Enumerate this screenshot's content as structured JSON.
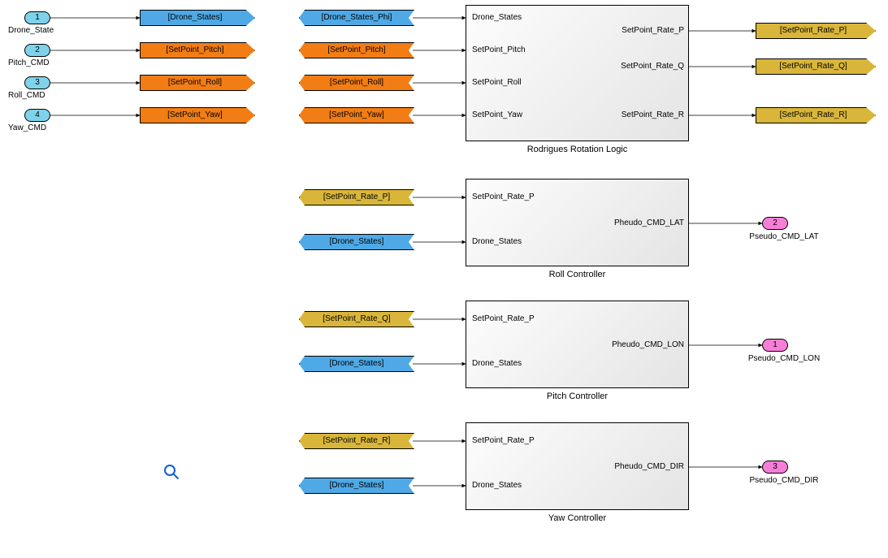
{
  "inports": [
    {
      "num": "1",
      "label": "Drone_State"
    },
    {
      "num": "2",
      "label": "Pitch_CMD"
    },
    {
      "num": "3",
      "label": "Roll_CMD"
    },
    {
      "num": "4",
      "label": "Yaw_CMD"
    }
  ],
  "goto_left": [
    {
      "text": "[Drone_States]",
      "color": "blue"
    },
    {
      "text": "[SetPoint_Pitch]",
      "color": "orange"
    },
    {
      "text": "[SetPoint_Roll]",
      "color": "orange"
    },
    {
      "text": "[SetPoint_Yaw]",
      "color": "orange"
    }
  ],
  "from_rr": [
    {
      "text": "[Drone_States_Phi]",
      "color": "blue"
    },
    {
      "text": "[SetPoint_Pitch]",
      "color": "orange"
    },
    {
      "text": "[SetPoint_Roll]",
      "color": "orange"
    },
    {
      "text": "[SetPoint_Yaw]",
      "color": "orange"
    }
  ],
  "rr_block": {
    "title": "Rodrigues Rotation Logic",
    "in": [
      "Drone_States",
      "SetPoint_Pitch",
      "SetPoint_Roll",
      "SetPoint_Yaw"
    ],
    "out": [
      "SetPoint_Rate_P",
      "SetPoint_Rate_Q",
      "SetPoint_Rate_R"
    ]
  },
  "goto_rr_out": [
    {
      "text": "[SetPoint_Rate_P]",
      "color": "gold"
    },
    {
      "text": "[SetPoint_Rate_Q]",
      "color": "gold"
    },
    {
      "text": "[SetPoint_Rate_R]",
      "color": "gold"
    }
  ],
  "ctrl_blocks": [
    {
      "title": "Roll  Controller",
      "from": [
        {
          "text": "[SetPoint_Rate_P]",
          "color": "gold"
        },
        {
          "text": "[Drone_States]",
          "color": "blue"
        }
      ],
      "in": [
        "SetPoint_Rate_P",
        "Drone_States"
      ],
      "out": "Pheudo_CMD_LAT",
      "outport": {
        "num": "2",
        "label": "Pseudo_CMD_LAT"
      }
    },
    {
      "title": "Pitch  Controller",
      "from": [
        {
          "text": "[SetPoint_Rate_Q]",
          "color": "gold"
        },
        {
          "text": "[Drone_States]",
          "color": "blue"
        }
      ],
      "in": [
        "SetPoint_Rate_P",
        "Drone_States"
      ],
      "out": "Pheudo_CMD_LON",
      "outport": {
        "num": "1",
        "label": "Pseudo_CMD_LON"
      }
    },
    {
      "title": "Yaw  Controller",
      "from": [
        {
          "text": "[SetPoint_Rate_R]",
          "color": "gold"
        },
        {
          "text": "[Drone_States]",
          "color": "blue"
        }
      ],
      "in": [
        "SetPoint_Rate_P",
        "Drone_States"
      ],
      "out": "Pheudo_CMD_DIR",
      "outport": {
        "num": "3",
        "label": "Pseudo_CMD_DIR"
      }
    }
  ],
  "zoom_tooltip": "Zoom"
}
